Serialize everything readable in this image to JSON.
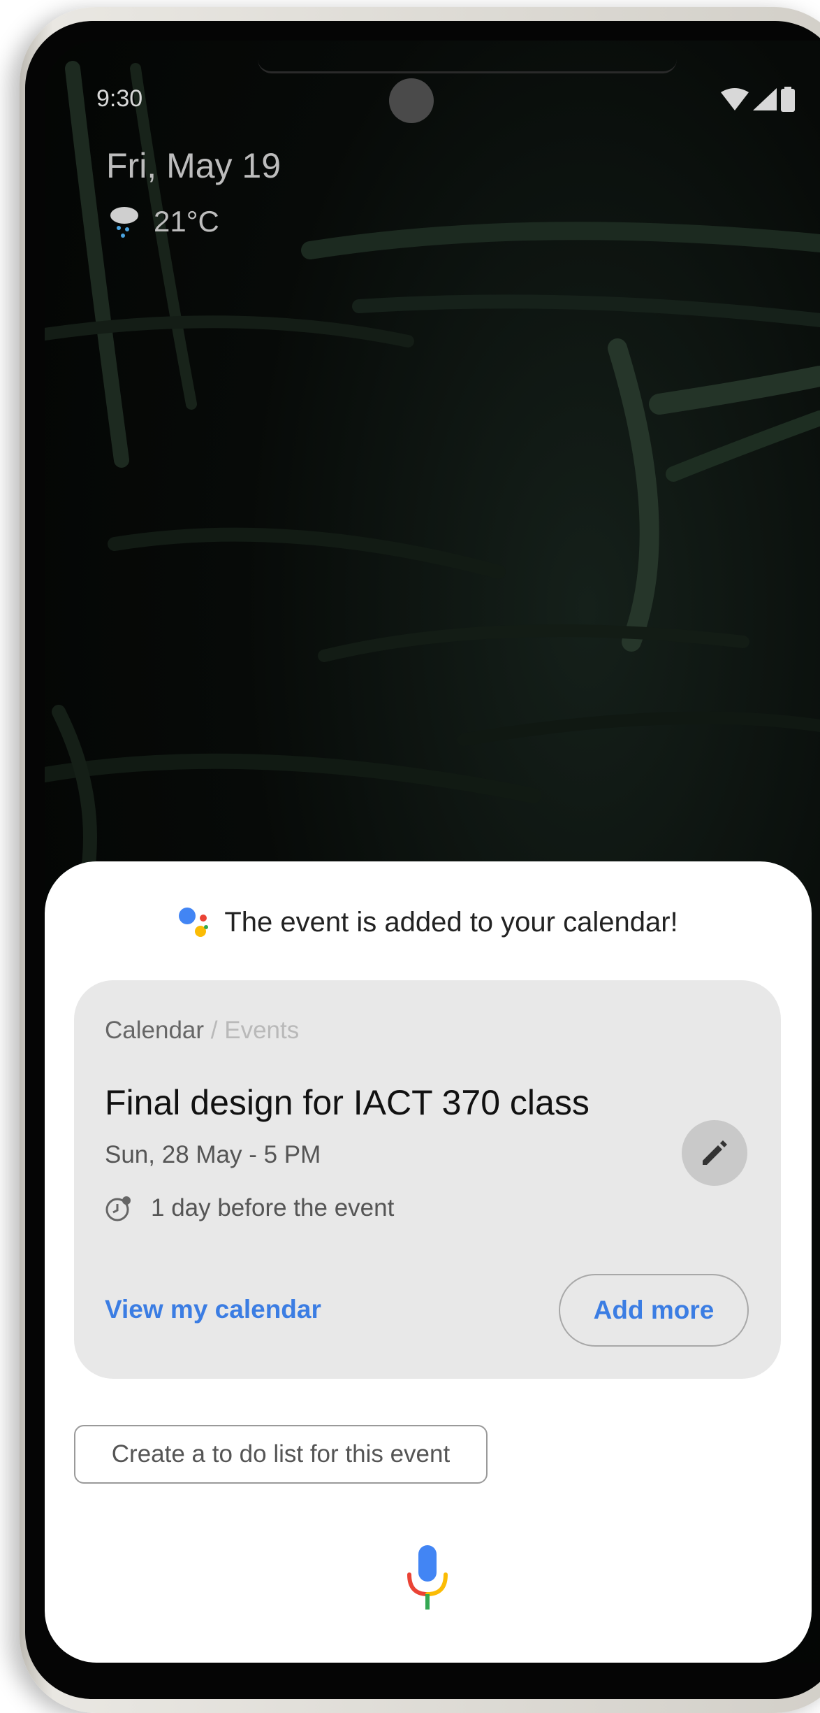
{
  "status_bar": {
    "time": "9:30",
    "icons": [
      "wifi-icon",
      "cell-signal-icon",
      "battery-icon"
    ]
  },
  "lockscreen": {
    "date": "Fri, May 19",
    "weather_icon": "rain-cloud-icon",
    "temperature": "21°C"
  },
  "assistant": {
    "message": "The event is added to your calendar!",
    "logo_colors": [
      "#4285F4",
      "#EA4335",
      "#FBBC05",
      "#34A853"
    ]
  },
  "card": {
    "breadcrumb_main": "Calendar",
    "breadcrumb_sub": " / Events",
    "event_title": "Final design for IACT 370 class",
    "event_datetime": "Sun, 28 May - 5 PM",
    "reminder_icon": "alarm-clock-icon",
    "reminder_text": "1 day before the event",
    "edit_icon": "pencil-icon",
    "view_calendar_label": "View my calendar",
    "add_more_label": "Add more"
  },
  "suggestion_chip": "Create a to do list for this event",
  "mic_icon": "microphone-icon",
  "colors": {
    "accent_blue": "#3B7DE3",
    "card_bg": "#E8E8E8",
    "sheet_bg": "#FFFFFF"
  }
}
